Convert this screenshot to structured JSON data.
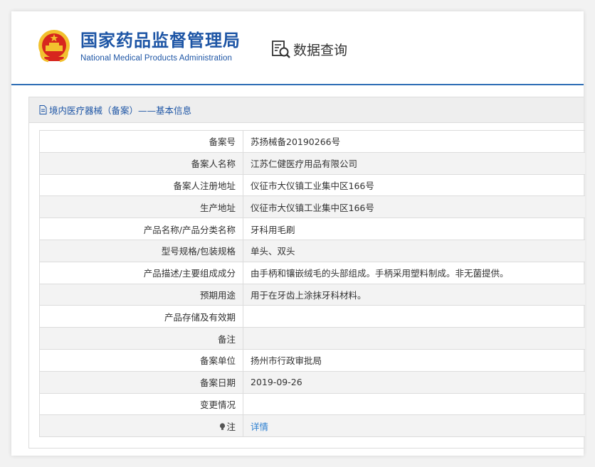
{
  "header": {
    "logo_cn": "国家药品监督管理局",
    "logo_en": "National Medical Products Administration",
    "query_label": "数据查询"
  },
  "panel": {
    "title": "境内医疗器械（备案）——基本信息"
  },
  "rows": [
    {
      "key": "备案号",
      "value": "苏扬械备20190266号"
    },
    {
      "key": "备案人名称",
      "value": "江苏仁健医疗用品有限公司"
    },
    {
      "key": "备案人注册地址",
      "value": "仪征市大仪镇工业集中区166号"
    },
    {
      "key": "生产地址",
      "value": "仪征市大仪镇工业集中区166号"
    },
    {
      "key": "产品名称/产品分类名称",
      "value": "牙科用毛刷"
    },
    {
      "key": "型号规格/包装规格",
      "value": "单头、双头"
    },
    {
      "key": "产品描述/主要组成成分",
      "value": "由手柄和镶嵌绒毛的头部组成。手柄采用塑料制成。非无菌提供。"
    },
    {
      "key": "预期用途",
      "value": "用于在牙齿上涂抹牙科材料。"
    },
    {
      "key": "产品存储及有效期",
      "value": ""
    },
    {
      "key": "备注",
      "value": ""
    },
    {
      "key": "备案单位",
      "value": "扬州市行政审批局"
    },
    {
      "key": "备案日期",
      "value": "2019-09-26"
    },
    {
      "key": "变更情况",
      "value": ""
    },
    {
      "key": "注",
      "value": "详情"
    }
  ],
  "colors": {
    "brand_blue": "#1d55a5",
    "link_blue": "#2b7fd1",
    "emblem_red": "#d7261e",
    "emblem_gold": "#f2c12e"
  },
  "icons": [
    "national-emblem-icon",
    "data-query-icon",
    "document-icon",
    "lightbulb-icon"
  ]
}
